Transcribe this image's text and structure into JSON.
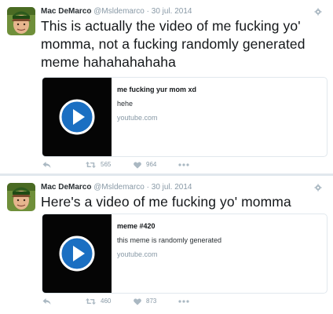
{
  "tweets": [
    {
      "author_name": "Mac DeMarco",
      "handle": "@Msldemarco",
      "separator": "·",
      "date": "30 jul. 2014",
      "text": "This is actually the video of me fucking yo' momma, not a fucking randomly generated meme hahahahahaha",
      "card": {
        "title": "me fucking yur mom xd",
        "description": "hehe",
        "domain": "youtube.com"
      },
      "retweets": "565",
      "likes": "964",
      "icons": [
        "reply-icon",
        "retweet-icon",
        "heart-icon",
        "more-icon",
        "gear-icon",
        "play-icon"
      ]
    },
    {
      "author_name": "Mac DeMarco",
      "handle": "@Msldemarco",
      "separator": "·",
      "date": "30 jul. 2014",
      "text": "Here's a video of me fucking yo' momma",
      "card": {
        "title": "meme #420",
        "description": "this meme is randomly generated",
        "domain": "youtube.com"
      },
      "retweets": "460",
      "likes": "873",
      "icons": [
        "reply-icon",
        "retweet-icon",
        "heart-icon",
        "more-icon",
        "gear-icon",
        "play-icon"
      ]
    }
  ],
  "colors": {
    "text": "#14171a",
    "muted": "#8899a6",
    "border": "#e1e8ed",
    "play_blue": "#1b6fc2",
    "thumb_bg": "#050505"
  }
}
